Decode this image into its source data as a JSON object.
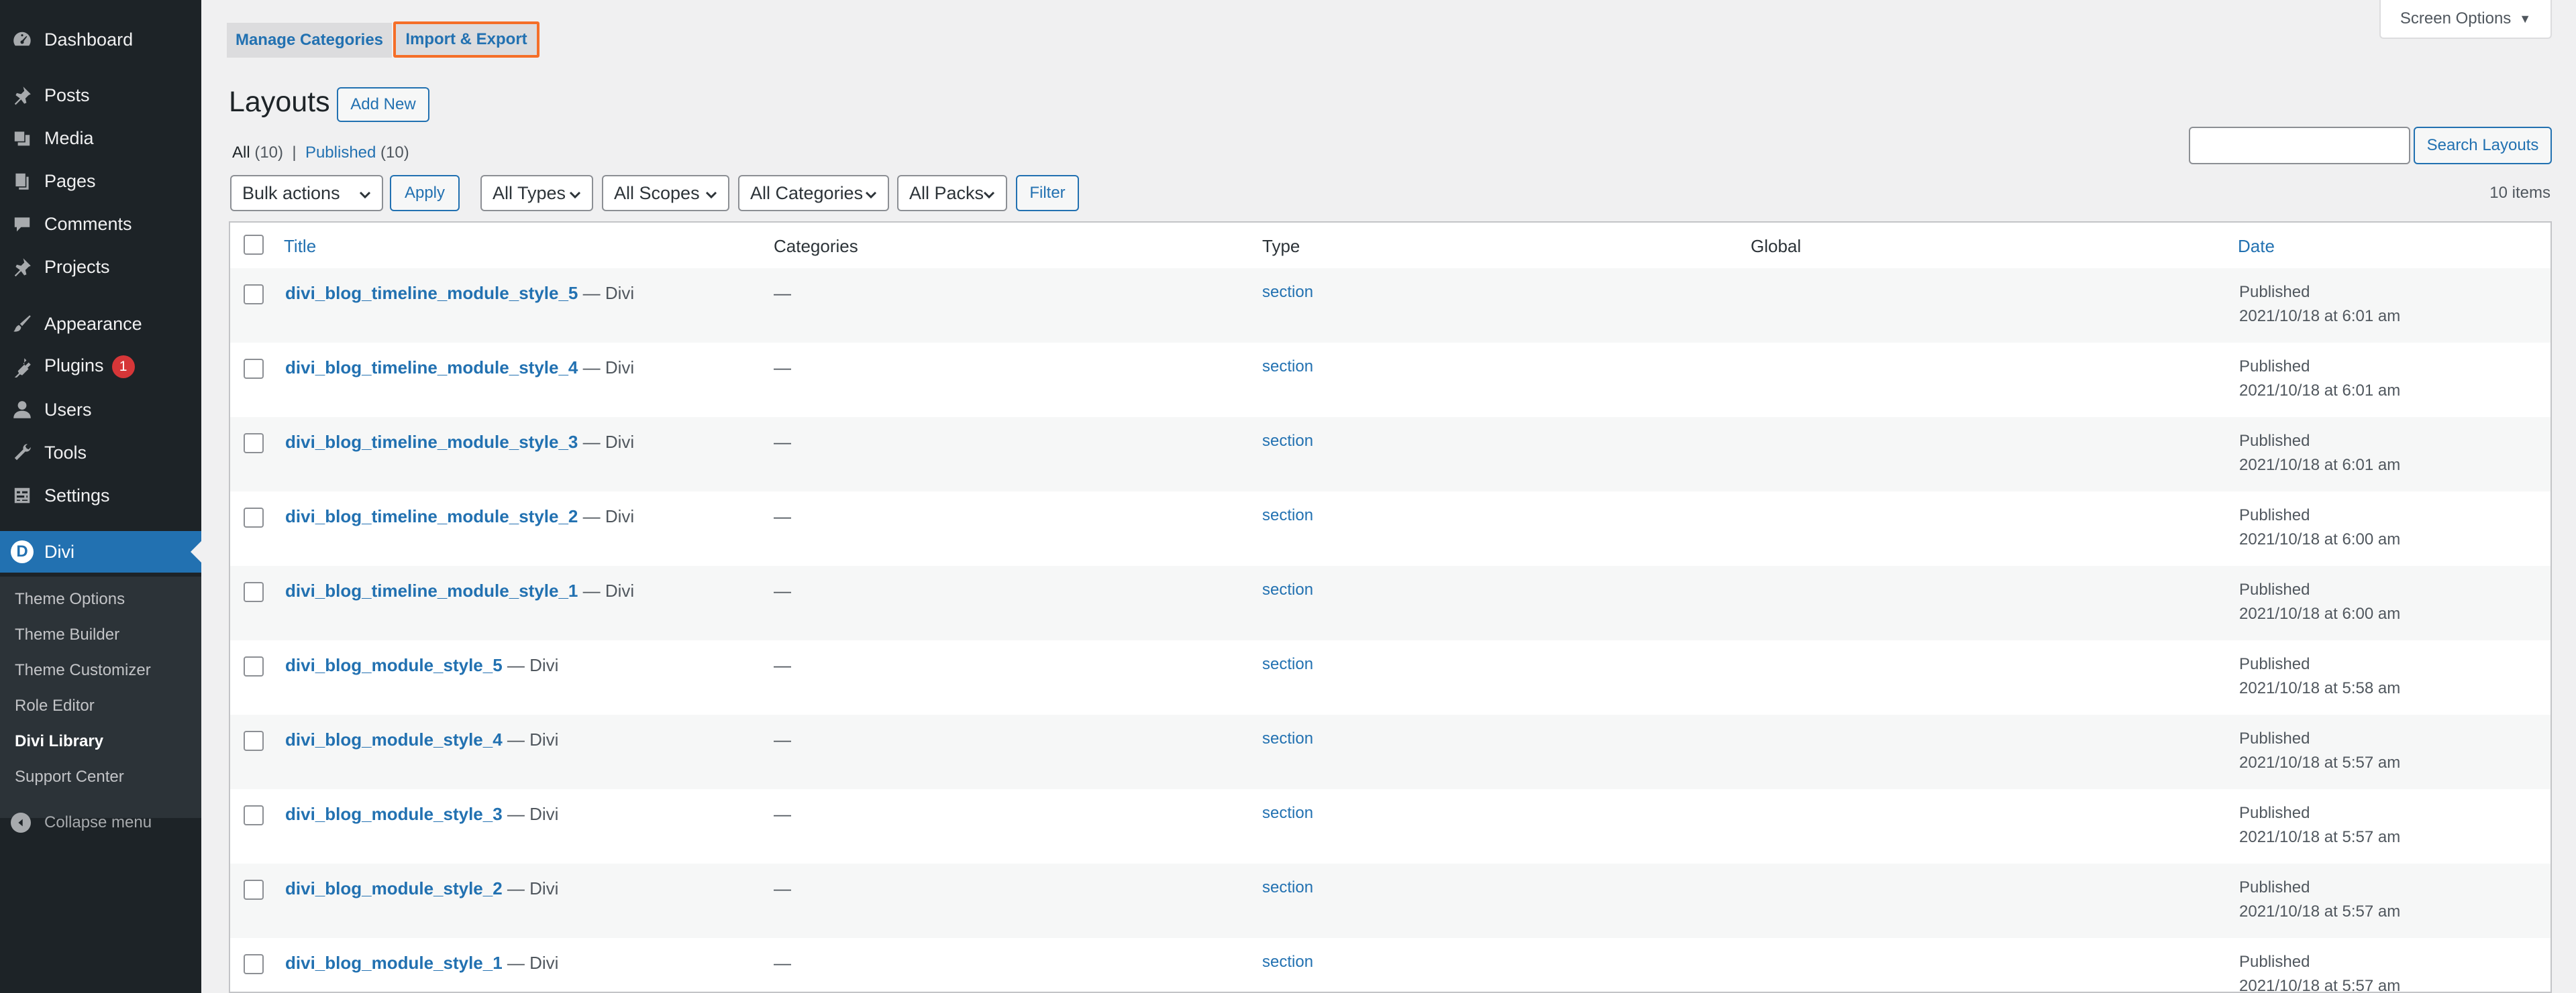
{
  "sidebar": {
    "items": [
      {
        "label": "Dashboard",
        "icon": "dashboard-icon"
      },
      {
        "label": "Posts",
        "icon": "pin-icon"
      },
      {
        "label": "Media",
        "icon": "media-icon"
      },
      {
        "label": "Pages",
        "icon": "pages-icon"
      },
      {
        "label": "Comments",
        "icon": "comment-icon"
      },
      {
        "label": "Projects",
        "icon": "pin-icon"
      },
      {
        "label": "Appearance",
        "icon": "brush-icon"
      },
      {
        "label": "Plugins",
        "icon": "plugin-icon",
        "badge": "1"
      },
      {
        "label": "Users",
        "icon": "user-icon"
      },
      {
        "label": "Tools",
        "icon": "wrench-icon"
      },
      {
        "label": "Settings",
        "icon": "settings-icon"
      },
      {
        "label": "Divi",
        "icon": "divi-icon",
        "logo_letter": "D"
      }
    ],
    "submenu": [
      {
        "label": "Theme Options"
      },
      {
        "label": "Theme Builder"
      },
      {
        "label": "Theme Customizer"
      },
      {
        "label": "Role Editor"
      },
      {
        "label": "Divi Library"
      },
      {
        "label": "Support Center"
      }
    ],
    "collapse_label": "Collapse menu"
  },
  "tabs": {
    "manage": "Manage Categories",
    "import": "Import & Export"
  },
  "screen_options": {
    "label": "Screen Options",
    "arrow": "▼"
  },
  "header": {
    "title": "Layouts",
    "add_new": "Add New"
  },
  "views": {
    "all": "All",
    "all_count": "(10)",
    "separator": "|",
    "published": "Published",
    "published_count": "(10)"
  },
  "search": {
    "button": "Search Layouts",
    "value": ""
  },
  "filters": {
    "bulk_actions": "Bulk actions",
    "apply": "Apply",
    "types": "All Types",
    "scopes": "All Scopes",
    "categories": "All Categories",
    "packs": "All Packs",
    "filter": "Filter"
  },
  "items_count": "10 items",
  "table": {
    "headers": {
      "title": "Title",
      "categories": "Categories",
      "type": "Type",
      "global": "Global",
      "date": "Date"
    },
    "rows": [
      {
        "title": "divi_blog_timeline_module_style_5",
        "suffix": "— Divi",
        "categories": "—",
        "type": "section",
        "status": "Published",
        "date": "2021/10/18 at 6:01 am"
      },
      {
        "title": "divi_blog_timeline_module_style_4",
        "suffix": "— Divi",
        "categories": "—",
        "type": "section",
        "status": "Published",
        "date": "2021/10/18 at 6:01 am"
      },
      {
        "title": "divi_blog_timeline_module_style_3",
        "suffix": "— Divi",
        "categories": "—",
        "type": "section",
        "status": "Published",
        "date": "2021/10/18 at 6:01 am"
      },
      {
        "title": "divi_blog_timeline_module_style_2",
        "suffix": "— Divi",
        "categories": "—",
        "type": "section",
        "status": "Published",
        "date": "2021/10/18 at 6:00 am"
      },
      {
        "title": "divi_blog_timeline_module_style_1",
        "suffix": "— Divi",
        "categories": "—",
        "type": "section",
        "status": "Published",
        "date": "2021/10/18 at 6:00 am"
      },
      {
        "title": "divi_blog_module_style_5",
        "suffix": "— Divi",
        "categories": "—",
        "type": "section",
        "status": "Published",
        "date": "2021/10/18 at 5:58 am"
      },
      {
        "title": "divi_blog_module_style_4",
        "suffix": "— Divi",
        "categories": "—",
        "type": "section",
        "status": "Published",
        "date": "2021/10/18 at 5:57 am"
      },
      {
        "title": "divi_blog_module_style_3",
        "suffix": "— Divi",
        "categories": "—",
        "type": "section",
        "status": "Published",
        "date": "2021/10/18 at 5:57 am"
      },
      {
        "title": "divi_blog_module_style_2",
        "suffix": "— Divi",
        "categories": "—",
        "type": "section",
        "status": "Published",
        "date": "2021/10/18 at 5:57 am"
      },
      {
        "title": "divi_blog_module_style_1",
        "suffix": "— Divi",
        "categories": "—",
        "type": "section",
        "status": "Published",
        "date": "2021/10/18 at 5:57 am"
      }
    ]
  },
  "colors": {
    "sidebar_bg": "#1d2327",
    "accent": "#2271b1",
    "highlight": "#f56e28",
    "badge": "#d63638"
  }
}
